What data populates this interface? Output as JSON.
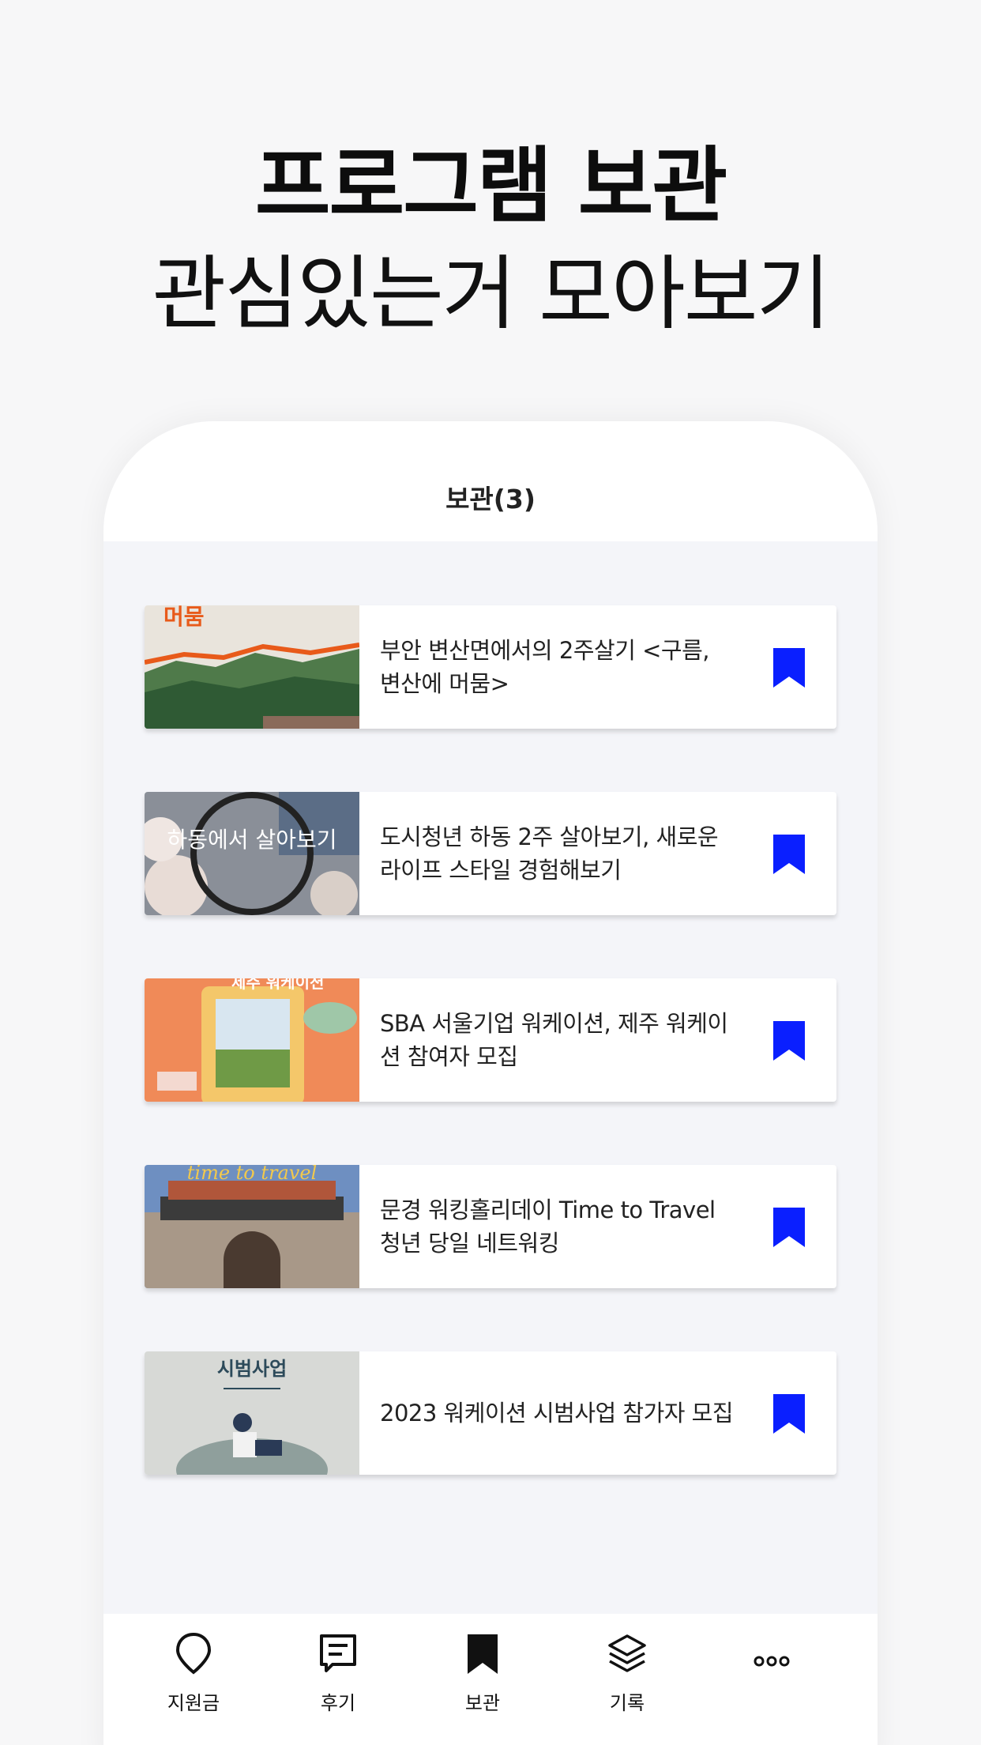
{
  "promo": {
    "headline": "프로그램 보관",
    "subline": "관심있는거 모아보기"
  },
  "screen": {
    "title": "보관(3)"
  },
  "items": [
    {
      "title": "부안 변산면에서의 2주살기 <구름, 변산에 머뭄>",
      "thumb_text": "머뭄",
      "bookmark_icon": "bookmark-filled-icon"
    },
    {
      "title": "도시청년 하동 2주 살아보기, 새로운 라이프 스타일 경험해보기",
      "thumb_text": "하동에서 살아보기",
      "bookmark_icon": "bookmark-filled-icon"
    },
    {
      "title": "SBA 서울기업 워케이션, 제주 워케이션 참여자 모집",
      "thumb_text": "제주 워케이션",
      "bookmark_icon": "bookmark-filled-icon"
    },
    {
      "title": "문경 워킹홀리데이 Time to Travel 청년 당일 네트워킹",
      "thumb_text": "time to travel",
      "bookmark_icon": "bookmark-filled-icon"
    },
    {
      "title": "2023 워케이션 시범사업 참가자 모집",
      "thumb_text": "시범사업",
      "bookmark_icon": "bookmark-filled-icon"
    }
  ],
  "tabs": [
    {
      "label": "지원금",
      "icon": "map-pin-icon"
    },
    {
      "label": "후기",
      "icon": "review-icon"
    },
    {
      "label": "보관",
      "icon": "bookmark-icon"
    },
    {
      "label": "기록",
      "icon": "layers-icon"
    },
    {
      "label": "",
      "icon": "more-icon"
    }
  ],
  "colors": {
    "accent": "#0a1fff",
    "background": "#f7f7f8",
    "list_background": "#f4f5f9"
  }
}
